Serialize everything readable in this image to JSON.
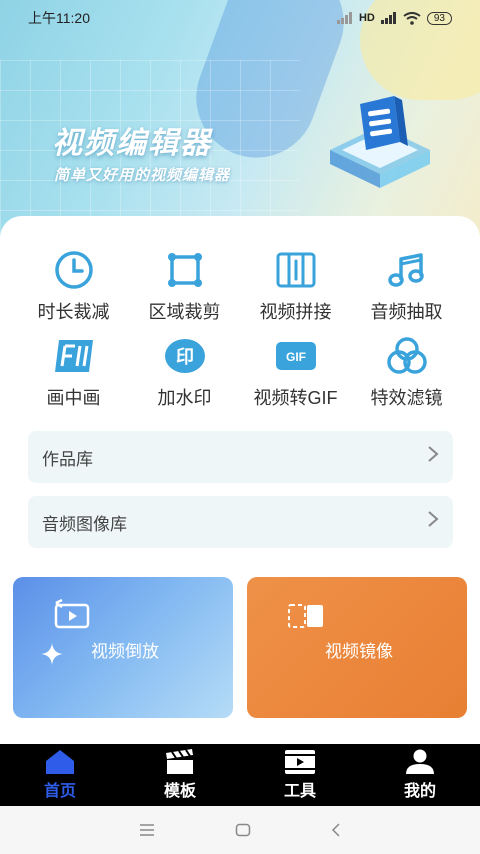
{
  "status": {
    "time": "上午11:20",
    "network": "HD",
    "battery": "93"
  },
  "hero": {
    "title": "视频编辑器",
    "subtitle": "简单又好用的视频编辑器"
  },
  "tools": [
    {
      "label": "时长裁减",
      "icon": "clock-icon"
    },
    {
      "label": "区域裁剪",
      "icon": "crop-icon"
    },
    {
      "label": "视频拼接",
      "icon": "film-strip-icon"
    },
    {
      "label": "音频抽取",
      "icon": "music-note-icon"
    },
    {
      "label": "画中画",
      "icon": "picture-in-picture-icon"
    },
    {
      "label": "加水印",
      "icon": "watermark-icon"
    },
    {
      "label": "视频转GIF",
      "icon": "gif-icon"
    },
    {
      "label": "特效滤镜",
      "icon": "filter-icon"
    }
  ],
  "libraries": {
    "works": "作品库",
    "audio_image": "音频图像库"
  },
  "features": {
    "reverse": "视频倒放",
    "mirror": "视频镜像"
  },
  "tabs": {
    "home": "首页",
    "templates": "模板",
    "tools": "工具",
    "mine": "我的"
  },
  "gif_badge": "GIF",
  "watermark_badge": "印",
  "colors": {
    "accent": "#2f5ce8",
    "icon_blue": "#3aa3dc",
    "orange": "#e87f33"
  }
}
